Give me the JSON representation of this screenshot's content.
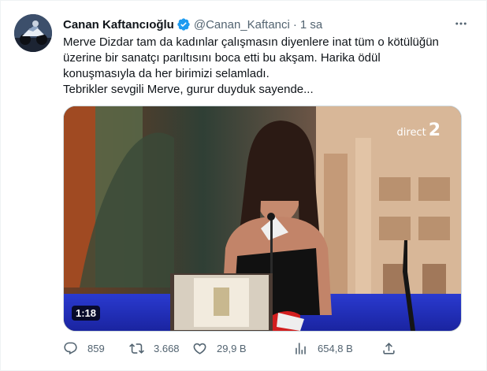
{
  "tweet": {
    "display_name": "Canan Kaftancıoğlu",
    "handle": "@Canan_Kaftanci",
    "separator": "·",
    "time": "1 sa",
    "text_lines": [
      "Merve Dizdar tam da kadınlar çalışmasın diyenlere inat tüm o kötülüğün",
      "üzerine bir sanatçı parıltısını boca etti bu akşam. Harika ödül",
      "konuşmasıyla da her birimizi selamladı.",
      "Tebrikler sevgili Merve, gurur duyduk sayende..."
    ]
  },
  "media": {
    "channel_logo_text": "direct",
    "channel_logo_number": "2",
    "duration": "1:18"
  },
  "actions": {
    "replies": "859",
    "retweets": "3.668",
    "likes": "29,9 B",
    "views": "654,8 B"
  },
  "icons": {
    "verified": "verified-badge-icon",
    "more": "more-options-icon",
    "reply": "reply-icon",
    "retweet": "retweet-icon",
    "like": "like-icon",
    "views": "views-icon",
    "share": "share-icon"
  },
  "colors": {
    "text": "#0f1419",
    "secondary": "#536471",
    "verified": "#1d9bf0",
    "border": "#cfd9de"
  }
}
